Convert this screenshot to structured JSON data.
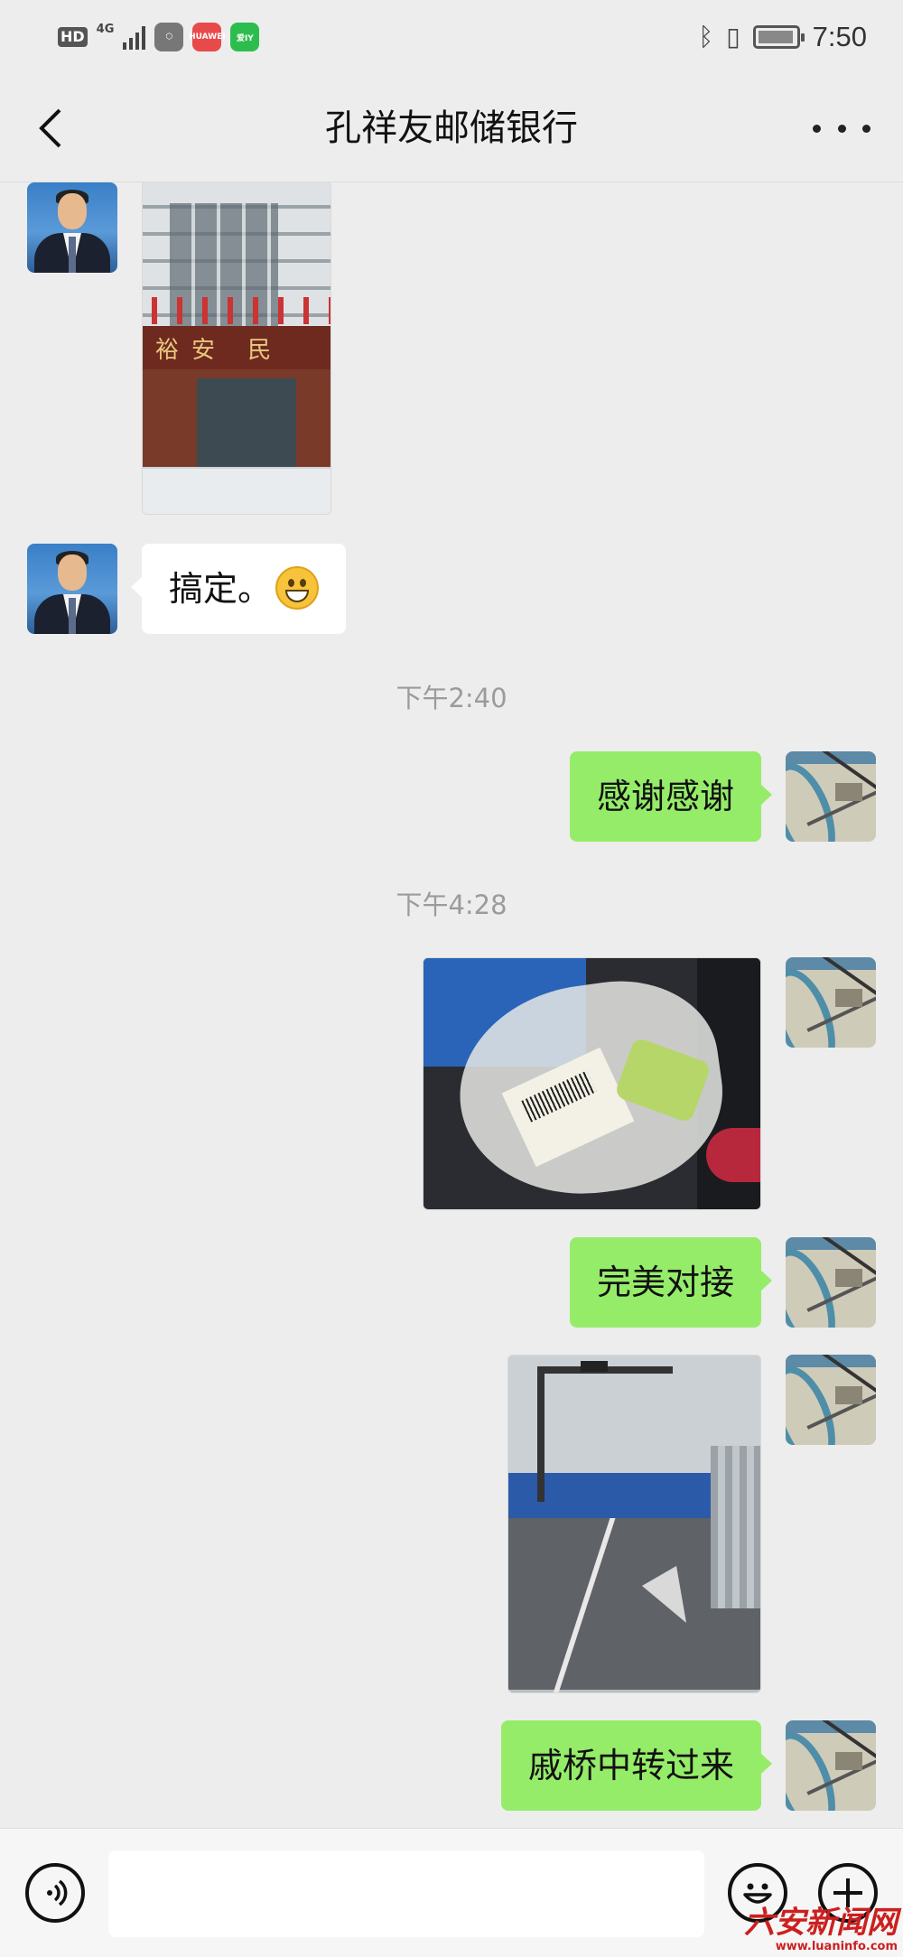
{
  "status_bar": {
    "hd": "HD",
    "network": "4G",
    "app_huawei": "HUAWEI",
    "app_iqiyi": "爱IY",
    "bluetooth_icon": "bluetooth-icon",
    "vibrate_icon": "vibrate-icon",
    "time": "7:50"
  },
  "header": {
    "title": "孔祥友邮储银行",
    "back_icon": "chevron-left-icon",
    "more_icon": "more-dots-icon"
  },
  "messages": [
    {
      "direction": "in",
      "type": "image",
      "description": "building photo",
      "sign_text": "裕安 民政"
    },
    {
      "direction": "in",
      "type": "text",
      "text": "搞定。",
      "emoji": "grinning-face"
    },
    {
      "type": "timestamp",
      "text": "下午2:40"
    },
    {
      "direction": "out",
      "type": "text",
      "text": "感谢感谢"
    },
    {
      "type": "timestamp",
      "text": "下午4:28"
    },
    {
      "direction": "out",
      "type": "image",
      "description": "plastic bag photo"
    },
    {
      "direction": "out",
      "type": "text",
      "text": "完美对接"
    },
    {
      "direction": "out",
      "type": "image",
      "description": "road photo"
    },
    {
      "direction": "out",
      "type": "text",
      "text": "戚桥中转过来"
    }
  ],
  "input_bar": {
    "voice_icon": "voice-icon",
    "input_value": "",
    "emoji_icon": "smiley-icon",
    "plus_icon": "plus-icon"
  },
  "watermark": {
    "text": "六安新闻网",
    "url": "www.luaninfo.com"
  },
  "colors": {
    "background": "#ededed",
    "outgoing_bubble": "#95ec69",
    "incoming_bubble": "#ffffff",
    "timestamp": "#9b9b9b"
  }
}
